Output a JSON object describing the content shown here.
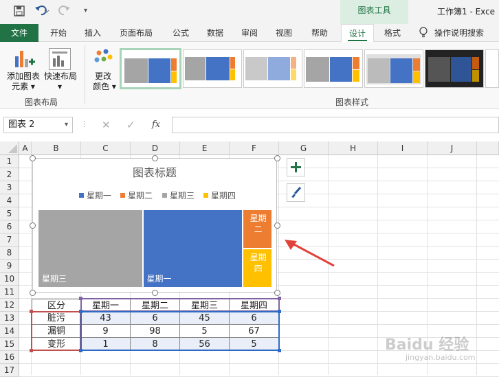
{
  "qat": {
    "save_icon": "save-icon",
    "undo_icon": "undo-icon",
    "redo_icon": "redo-icon",
    "customize_icon": "customize-qat-icon"
  },
  "title": {
    "contextual_tab": "图表工具",
    "workbook": "工作簿1 - Exce"
  },
  "tabs": [
    "文件",
    "开始",
    "插入",
    "页面布局",
    "公式",
    "数据",
    "审阅",
    "视图",
    "帮助",
    "设计",
    "格式"
  ],
  "tell_me": "操作说明搜索",
  "ribbon": {
    "add_element": [
      "添加图表",
      "元素"
    ],
    "quick_layout": "快速布局",
    "change_color": [
      "更改",
      "颜色"
    ],
    "group_layout": "图表布局",
    "group_styles": "图表样式"
  },
  "formula": {
    "name_box": "图表 2",
    "fx": "fx"
  },
  "columns": [
    "A",
    "B",
    "C",
    "D",
    "E",
    "F",
    "G",
    "H",
    "I",
    "J"
  ],
  "rows": [
    "1",
    "2",
    "3",
    "4",
    "5",
    "6",
    "7",
    "8",
    "9",
    "10",
    "11",
    "12",
    "13",
    "14",
    "15",
    "16",
    "17"
  ],
  "colors": {
    "blue": "#4472c4",
    "orange": "#ed7d31",
    "gray": "#a5a5a5",
    "yellow": "#ffc000",
    "excel_green": "#217346"
  },
  "chart_data": {
    "type": "treemap",
    "title": "图表标题",
    "legend": [
      "星期一",
      "星期二",
      "星期三",
      "星期四"
    ],
    "legend_position": "top",
    "categories": [
      "星期一",
      "星期二",
      "星期三",
      "星期四"
    ],
    "values": [
      43,
      6,
      45,
      6
    ],
    "source_row": "脏污",
    "tiles": [
      {
        "label": "星期三",
        "value": 45,
        "color": "#a5a5a5"
      },
      {
        "label": "星期一",
        "value": 43,
        "color": "#4472c4"
      },
      {
        "label": "星期二",
        "value": 6,
        "color": "#ed7d31"
      },
      {
        "label": "星期四",
        "value": 6,
        "color": "#ffc000"
      }
    ]
  },
  "table": {
    "header": [
      "区分",
      "星期一",
      "星期二",
      "星期三",
      "星期四"
    ],
    "rows": [
      [
        "脏污",
        "43",
        "6",
        "45",
        "6"
      ],
      [
        "漏铜",
        "9",
        "98",
        "5",
        "67"
      ],
      [
        "变形",
        "1",
        "8",
        "56",
        "5"
      ]
    ]
  },
  "watermark": {
    "brand": "Baidu 经验",
    "url": "jingyan.baidu.com"
  }
}
